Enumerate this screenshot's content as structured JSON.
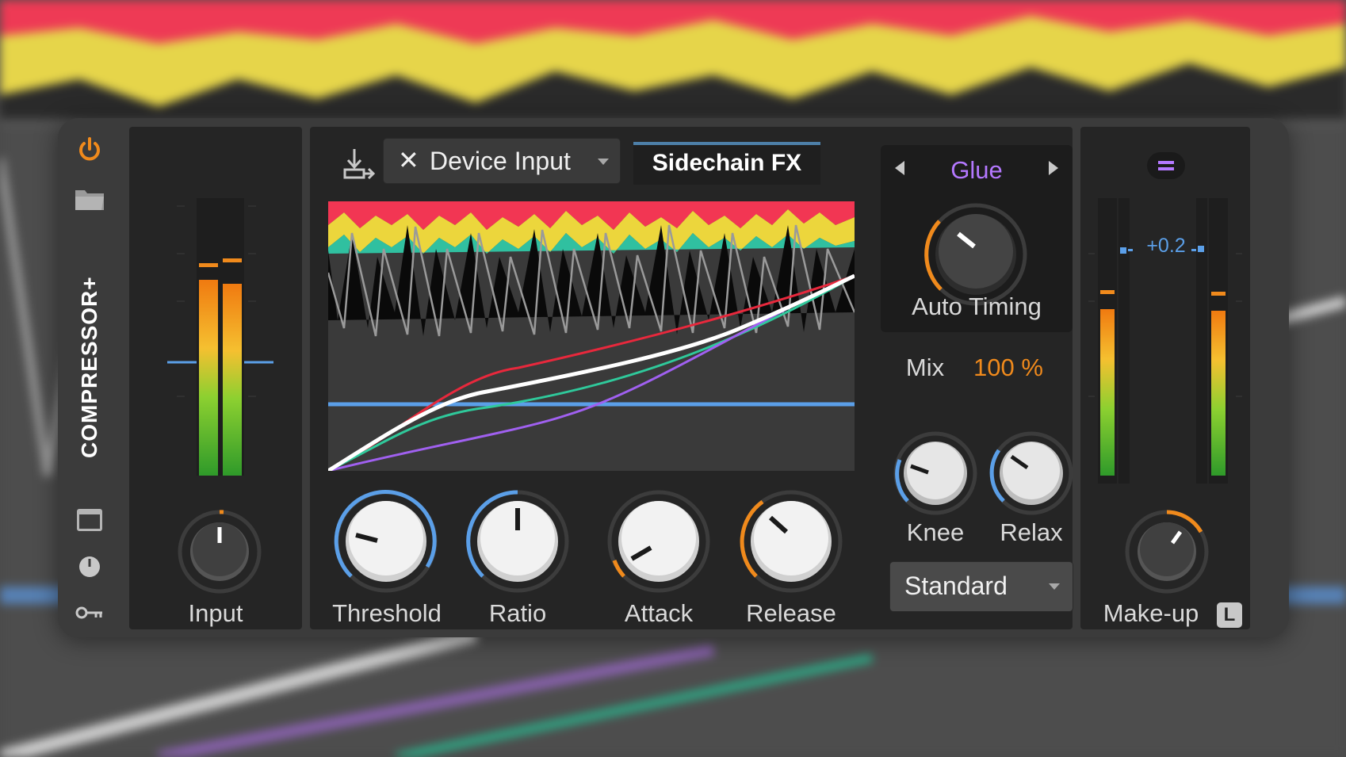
{
  "device": {
    "name": "COMPRESSOR+",
    "power_state": "on",
    "accent_color": "#f08a1c"
  },
  "input_section": {
    "knob_label": "Input",
    "knob_value_fraction": 0.5
  },
  "sidechain": {
    "source_label": "Device Input",
    "fx_label": "Sidechain FX"
  },
  "main_knobs": [
    {
      "label": "Threshold",
      "value_fraction": 0.92,
      "arc_color": "#5b9fe8"
    },
    {
      "label": "Ratio",
      "value_fraction": 0.5,
      "arc_color": "#5b9fe8"
    },
    {
      "label": "Attack",
      "value_fraction": 0.18,
      "arc_color": "#f08a1c"
    },
    {
      "label": "Release",
      "value_fraction": 0.36,
      "arc_color": "#f08a1c"
    }
  ],
  "character": {
    "preset_name": "Glue",
    "preset_color": "#b478ff",
    "auto_timing_label": "Auto Timing",
    "auto_timing_fraction": 0.35
  },
  "mix": {
    "label": "Mix",
    "value": "100 %"
  },
  "knee": {
    "label": "Knee",
    "value_fraction": 0.2
  },
  "relax": {
    "label": "Relax",
    "value_fraction": 0.28
  },
  "mode_dropdown": {
    "selected": "Standard"
  },
  "output_section": {
    "gain_readout": "+0.2",
    "knob_label": "Make-up",
    "knob_value_fraction": 0.75,
    "lock_label": "L"
  },
  "colors": {
    "threshold_line": "#5b9fe8",
    "curve_red": "#e8283c",
    "curve_green": "#2fc99b",
    "curve_purple": "#a060f0",
    "curve_white": "#ffffff",
    "meter_orange": "#f08a1c"
  }
}
